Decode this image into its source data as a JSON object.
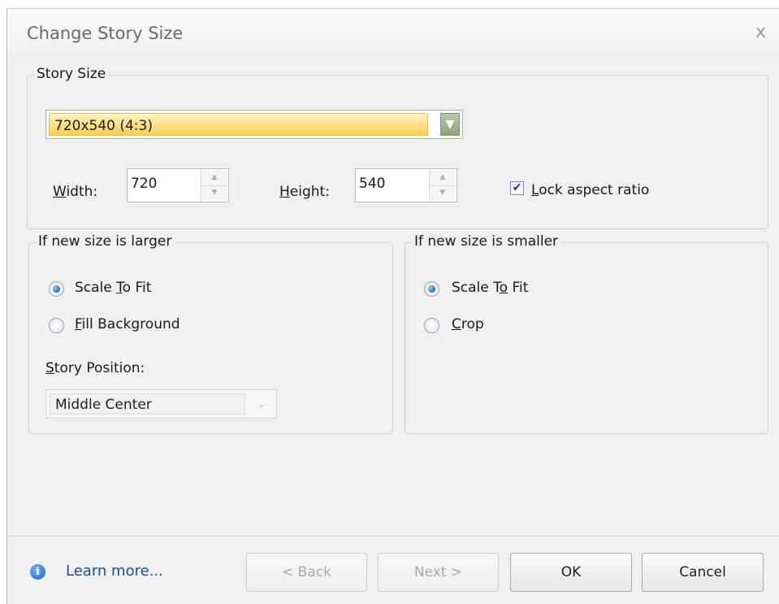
{
  "window": {
    "title": "Change Story Size",
    "close_glyph": "x"
  },
  "story_size": {
    "group_label": "Story Size",
    "preset_value": "720x540 (4:3)",
    "width_label": "Width:",
    "width_value": "720",
    "height_label": "Height:",
    "height_value": "540",
    "lock_label": "Lock aspect ratio",
    "lock_checked": true
  },
  "larger": {
    "group_label": "If new size is larger",
    "options": [
      {
        "label": "Scale To Fit",
        "selected": true
      },
      {
        "label": "Fill Background",
        "selected": false
      }
    ],
    "position_label": "Story Position:",
    "position_value": "Middle Center"
  },
  "smaller": {
    "group_label": "If new size is smaller",
    "options": [
      {
        "label": "Scale To Fit",
        "selected": true
      },
      {
        "label": "Crop",
        "selected": false
      }
    ]
  },
  "footer": {
    "learn_more": "Learn more...",
    "back": "< Back",
    "next": "Next >",
    "ok": "OK",
    "cancel": "Cancel"
  },
  "icons": {
    "info": "info-icon",
    "dropdown": "chevron-down-icon",
    "spin_up": "spin-up-icon",
    "spin_down": "spin-down-icon"
  },
  "colors": {
    "combo_highlight": "#ffe28a",
    "combo_button": "#8ba379",
    "link": "#1c4f9c"
  }
}
